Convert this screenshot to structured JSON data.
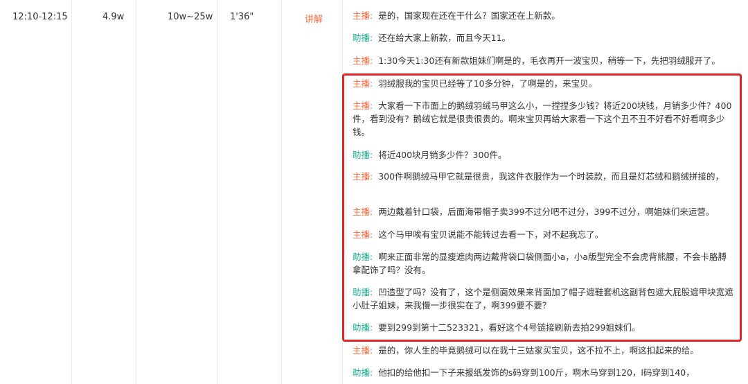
{
  "row": {
    "time": "12:10-12:15",
    "count": "4.9w",
    "range": "10w~25w",
    "duration": "1'36\"",
    "type": "讲解"
  },
  "transcript": [
    {
      "role": "主播",
      "text": "是的，国家现在还在干什么？国家还在上新款。"
    },
    {
      "role": "助播",
      "text": "还在给大家上新款，而且今天11。"
    },
    {
      "role": "主播",
      "text": "1:30今天1:30还有新款姐妹们啊是的，毛衣再开一波宝贝，稍等一下，先把羽绒服开了。"
    },
    {
      "role": "主播",
      "text": "羽绒服我的宝贝已经等了10多分钟，了啊是的，来宝贝。"
    },
    {
      "role": "主播",
      "text": "大家看一下市面上的鹅绒羽绒马甲这么小，一捏捏多少钱？将近200块钱，月销多少件？400件，看到没有？鹅绒它就是很贵很贵的。啊来宝贝再给大家看一下这个丑不丑不好看不好看啊多少钱。"
    },
    {
      "role": "助播",
      "text": "将近400块月销多少件？300件。"
    },
    {
      "role": "主播",
      "text": "300件啊鹅绒马甲它就是很贵，我这件衣服作为一个时装款，而且是灯芯绒和鹅绒拼接的，"
    },
    {
      "role": "主播",
      "text": "两边戴着针口袋，后面海带帽子卖399不过分吧不过分，399不过分，啊姐妹们来运营。"
    },
    {
      "role": "主播",
      "text": "这个马甲唉有宝贝说能不能转过去看一下，对不起我忘了。"
    },
    {
      "role": "助播",
      "text": "啊来正面非常的显瘦遮肉两边戴背袋口袋侧面小a，小a版型完全不会虎背熊腰，不会卡胳膊拿配饰了吗？没有。"
    },
    {
      "role": "助播",
      "text": "凹造型了吗？没有了，这个是侧面效果来背面加了帽子遮鞋套机这副背包遮大屁股遮甲块宽遮小肚子姐妹，来我慢一步很实在了，啊399要不要？"
    },
    {
      "role": "助播",
      "text": "要到299到第十二523321，看好这个4号链接刷新去拍299姐妹们。"
    },
    {
      "role": "主播",
      "text": "是的，你人生的毕竟鹅绒可以在我十三姑家买宝贝，这不拉不上，啊这扣起来的给。"
    },
    {
      "role": "助播",
      "text": "他扣的给他扣一下子来报纸发饰的s码穿到100斤，啊木马穿到120，l码穿到140，"
    }
  ],
  "colors": {
    "host": "#ff6a3d",
    "assistant": "#1bb28d",
    "highlight": "#e02424"
  }
}
